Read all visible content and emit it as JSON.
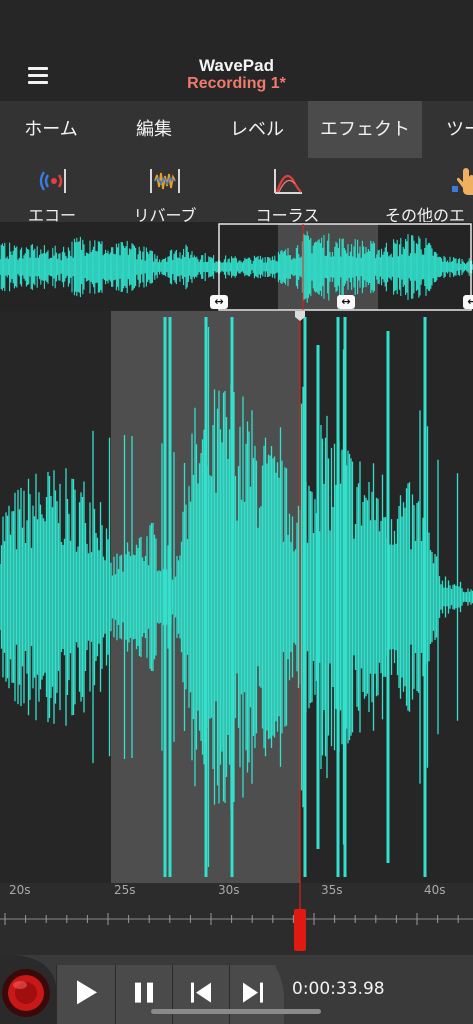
{
  "app": {
    "title": "WavePad",
    "document": "Recording 1*"
  },
  "tabs": [
    {
      "label": "ホーム",
      "active": false
    },
    {
      "label": "編集",
      "active": false
    },
    {
      "label": "レベル",
      "active": false
    },
    {
      "label": "エフェクト",
      "active": true
    },
    {
      "label": "ツー",
      "active": false
    }
  ],
  "toolbar": [
    {
      "label": "エコー",
      "icon": "echo-icon"
    },
    {
      "label": "リバーブ",
      "icon": "reverb-icon"
    },
    {
      "label": "コーラス",
      "icon": "chorus-icon"
    },
    {
      "label": "その他のエ",
      "icon": "more-effects-icon"
    }
  ],
  "timeline": {
    "labels": [
      "20s",
      "25s",
      "30s",
      "35s",
      "40s"
    ]
  },
  "transport": {
    "time": "0:00:33.98"
  },
  "colors": {
    "waveform": "#32e0cc",
    "selection": "#4e4e4e",
    "playhead": "#e0201a",
    "accent_title": "#f07a6e"
  }
}
